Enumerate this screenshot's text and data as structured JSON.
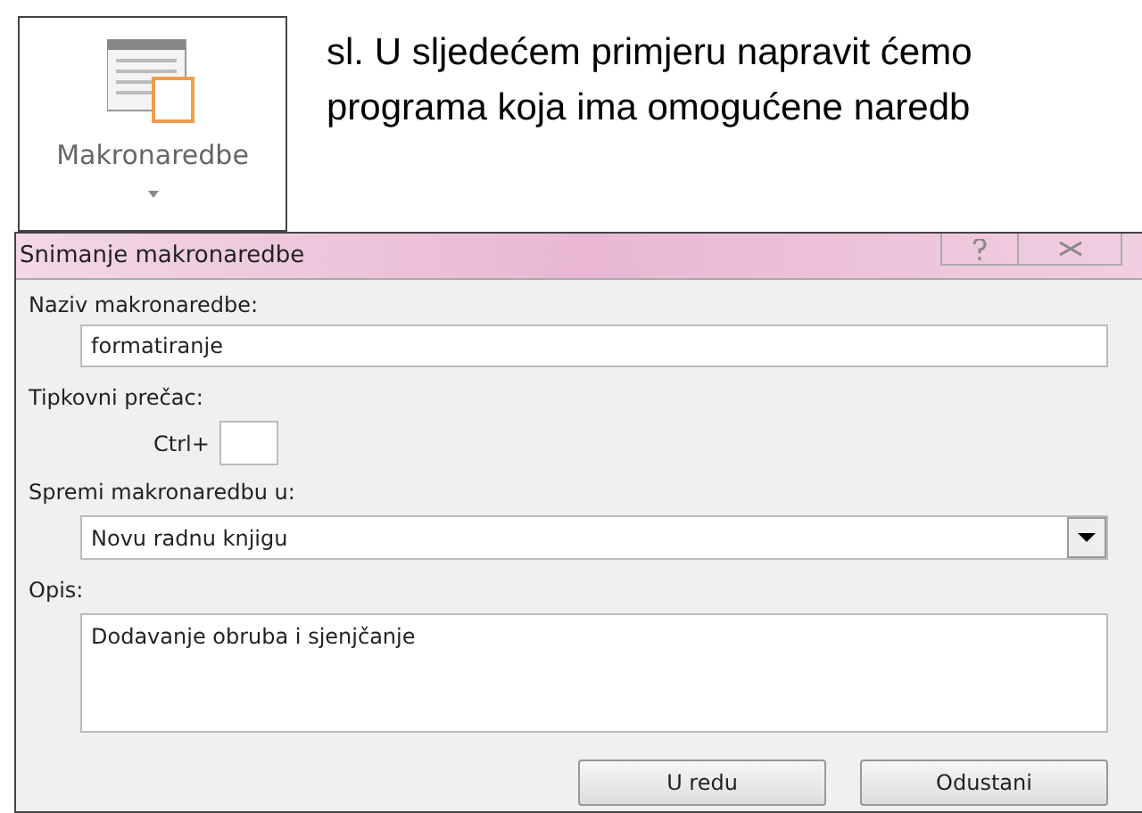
{
  "ribbon_button": {
    "label": "Makronaredbe"
  },
  "body_text": [
    "sl. U sljedećem primjeru napravit ćemo",
    "programa koja ima omogućene naredb"
  ],
  "dialog": {
    "title": "Snimanje makronaredbe",
    "name_label": "Naziv makronaredbe:",
    "name_value": "formatiranje",
    "shortcut_label": "Tipkovni prečac:",
    "shortcut_prefix": "Ctrl+",
    "store_label": "Spremi makronaredbu u:",
    "store_value": "Novu radnu knjigu",
    "description_label": "Opis:",
    "description_value": "Dodavanje obruba i sjenjčanje",
    "buttons": [
      "U redu",
      "Odustani"
    ]
  }
}
